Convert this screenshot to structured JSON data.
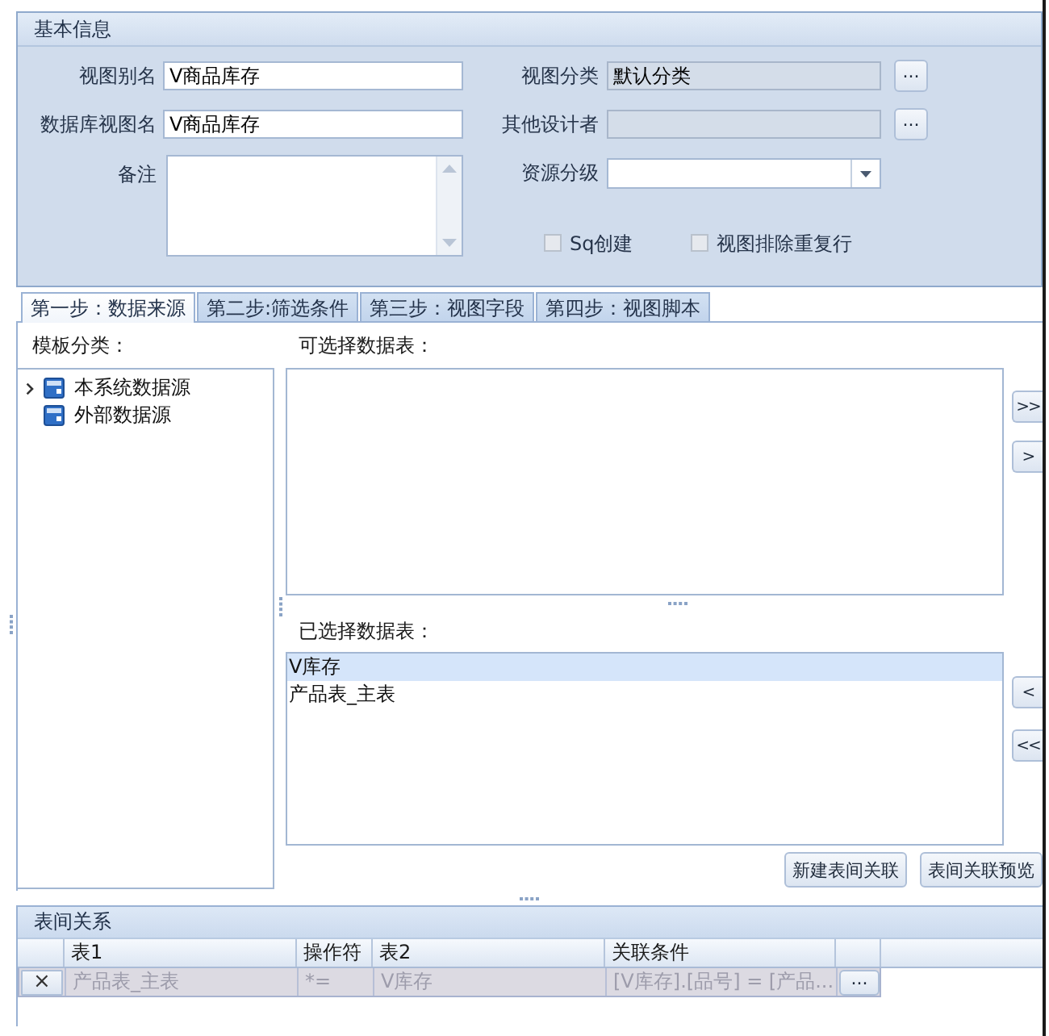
{
  "basic_info": {
    "title": "基本信息",
    "left_fields": [
      {
        "kind": "text",
        "label": "视图别名",
        "value": "V商品库存",
        "disabled": false
      },
      {
        "kind": "text",
        "label": "数据库视图名",
        "value": "V商品库存",
        "disabled": false
      },
      {
        "kind": "memo",
        "label": "备注",
        "disabled": false
      }
    ],
    "right_fields": [
      {
        "kind": "text",
        "label": "视图分类",
        "value": "默认分类",
        "disabled": true,
        "button": "..."
      },
      {
        "kind": "text",
        "label": "其他设计者",
        "disabled": true,
        "button": "..."
      },
      {
        "kind": "combo",
        "label": "资源分级",
        "disabled": false
      }
    ],
    "checkboxes": [
      {
        "label": "Sq创建",
        "checked": false
      },
      {
        "label": "视图排除重复行",
        "checked": false
      }
    ]
  },
  "tabs": [
    {
      "label": "第一步：数据来源",
      "selected": true
    },
    {
      "label": "第二步:筛选条件",
      "selected": false
    },
    {
      "label": "第三步：视图字段",
      "selected": false
    },
    {
      "label": "第四步：视图脚本",
      "selected": false
    }
  ],
  "data_source_step": {
    "template_label": "模板分类：",
    "tree": [
      {
        "label": "本系统数据源",
        "expandable": true,
        "expanded": false
      },
      {
        "label": "外部数据源",
        "expandable": false,
        "expanded": false
      }
    ],
    "available_label": "可选择数据表：",
    "add_buttons": [
      ">>",
      ">"
    ],
    "selected_label": "已选择数据表：",
    "selected_tables": [
      {
        "label": "V库存",
        "selected": true
      },
      {
        "label": "产品表_主表",
        "selected": false
      }
    ],
    "remove_buttons": [
      "<",
      "<<"
    ],
    "action_buttons": [
      "新建表间关联",
      "表间关联预览"
    ]
  },
  "relations": {
    "title": "表间关系",
    "columns": [
      "表1",
      "操作符",
      "表2",
      "关联条件"
    ],
    "rows": [
      {
        "delete": "×",
        "table1": "产品表_主表",
        "operator": "*=",
        "table2": "V库存",
        "condition": "[V库存].[品号] = [产品...",
        "edit": "...",
        "disabled": true
      }
    ]
  }
}
